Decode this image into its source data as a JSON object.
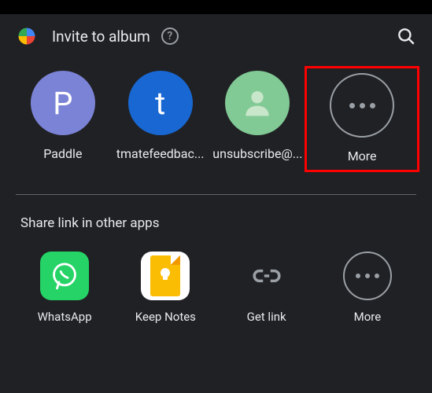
{
  "header": {
    "title": "Invite to album"
  },
  "contacts": [
    {
      "label": "Paddle",
      "initial": "P"
    },
    {
      "label": "tmatefeedbac...",
      "initial": "t"
    },
    {
      "label": "unsubscribe@..."
    },
    {
      "label": "More"
    }
  ],
  "share_section": {
    "title": "Share link in other apps"
  },
  "apps": [
    {
      "label": "WhatsApp"
    },
    {
      "label": "Keep Notes"
    },
    {
      "label": "Get link"
    },
    {
      "label": "More"
    }
  ]
}
